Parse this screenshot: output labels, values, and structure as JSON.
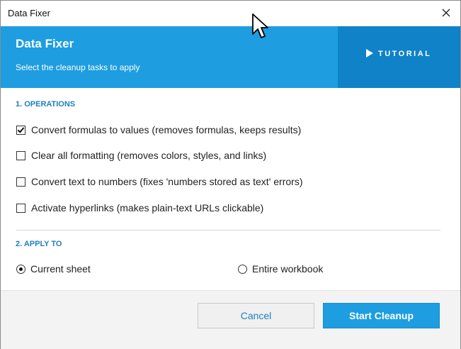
{
  "window": {
    "title": "Data Fixer",
    "close_icon": "close-icon"
  },
  "header": {
    "title": "Data Fixer",
    "subtitle": "Select the cleanup tasks to apply",
    "tutorial_label": "TUTORIAL",
    "tutorial_icon": "play-icon",
    "accent_color": "#1e9de0",
    "tutorial_bg_color": "#0f82c8"
  },
  "operations": {
    "title": "1. OPERATIONS",
    "items": [
      {
        "label": "Convert formulas to values (removes formulas, keeps results)",
        "checked": true
      },
      {
        "label": "Clear all formatting (removes colors, styles, and links)",
        "checked": false
      },
      {
        "label": "Convert text to numbers (fixes 'numbers stored as text' errors)",
        "checked": false
      },
      {
        "label": "Activate hyperlinks (makes plain-text URLs clickable)",
        "checked": false
      }
    ]
  },
  "apply_to": {
    "title": "2. APPLY TO",
    "options": [
      {
        "label": "Current sheet",
        "selected": true
      },
      {
        "label": "Entire workbook",
        "selected": false
      }
    ]
  },
  "footer": {
    "cancel_label": "Cancel",
    "start_label": "Start Cleanup"
  }
}
